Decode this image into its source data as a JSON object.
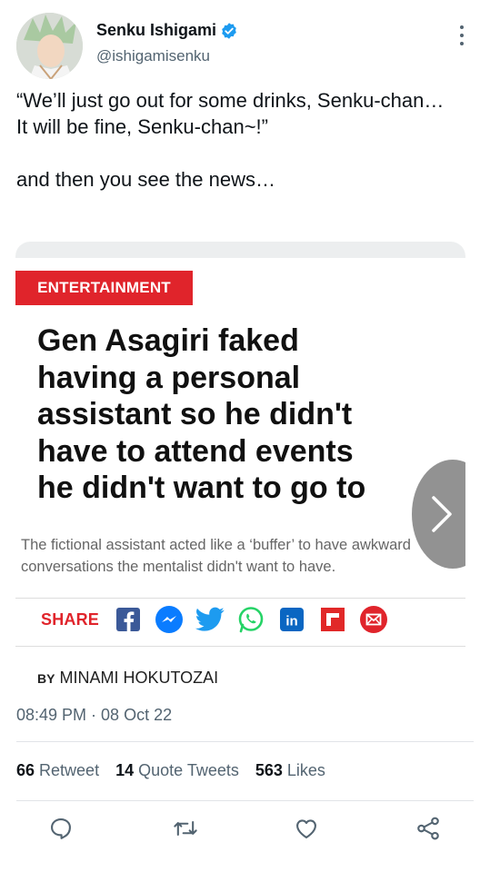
{
  "user": {
    "display_name": "Senku Ishigami",
    "handle": "@ishigamisenku",
    "verified": true
  },
  "tweet": {
    "lines": [
      "“We’ll just go out for some drinks, Senku-chan… It will be fine, Senku-chan~!”",
      "and then you see the news…"
    ]
  },
  "article": {
    "category": "ENTERTAINMENT",
    "headline": "Gen Asagiri faked\nhaving a personal\nassistant so he didn't\nhave to attend events\nhe didn't want to go to",
    "subhead": "The fictional assistant acted like a ‘buffer’ to have awkward conversations the mentalist didn't want to have.",
    "share_label": "SHARE",
    "share_icons": [
      "facebook-icon",
      "messenger-icon",
      "twitter-icon",
      "whatsapp-icon",
      "linkedin-icon",
      "flipboard-icon",
      "email-icon"
    ],
    "byline_prefix": "BY",
    "author": "MINAMI HOKUTOZAI"
  },
  "meta": {
    "timestamp": "08:49 PM · 08 Oct 22"
  },
  "stats": {
    "retweets_count": "66",
    "retweets_label": "Retweet",
    "quotes_count": "14",
    "quotes_label": "Quote Tweets",
    "likes_count": "563",
    "likes_label": "Likes"
  },
  "actions": [
    "reply-icon",
    "retweet-icon",
    "like-icon",
    "share-icon"
  ],
  "colors": {
    "accent_blue": "#1d9bf0",
    "category_red": "#e0242b",
    "muted_text": "#536471"
  }
}
